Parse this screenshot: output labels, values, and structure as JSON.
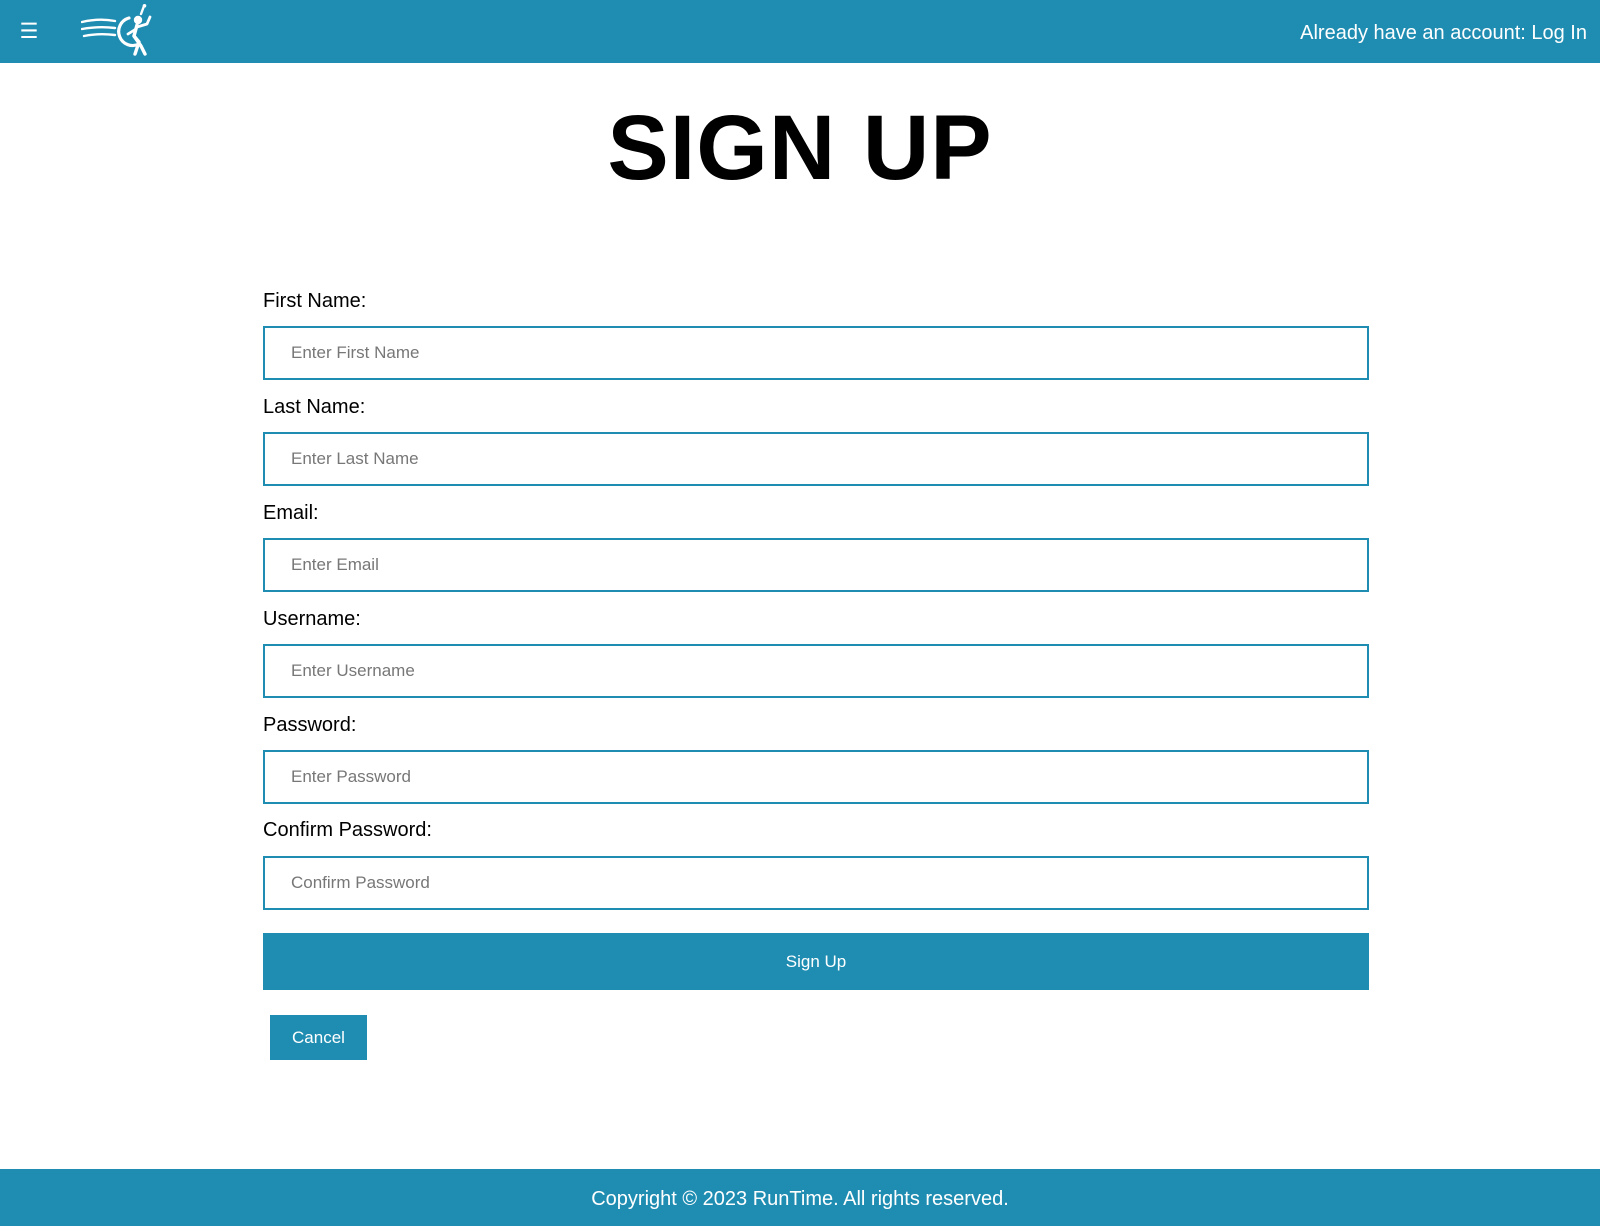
{
  "header": {
    "menu_icon_glyph": "☰",
    "logo_icon": "runner-logo-icon",
    "login_text": "Already have an account: Log In"
  },
  "page": {
    "title": "SIGN UP"
  },
  "form": {
    "fields": [
      {
        "label": "First Name:",
        "placeholder": "Enter First Name",
        "value": ""
      },
      {
        "label": "Last Name:",
        "placeholder": "Enter Last Name",
        "value": ""
      },
      {
        "label": "Email:",
        "placeholder": "Enter Email",
        "value": ""
      },
      {
        "label": "Username:",
        "placeholder": "Enter Username",
        "value": ""
      },
      {
        "label": "Password:",
        "placeholder": "Enter Password",
        "value": ""
      },
      {
        "label": "Confirm Password:",
        "placeholder": "Confirm Password",
        "value": ""
      }
    ],
    "submit_label": "Sign Up",
    "cancel_label": "Cancel"
  },
  "footer": {
    "copyright": "Copyright © 2023 RunTime. All rights reserved."
  },
  "colors": {
    "brand": "#1f8db2",
    "text_on_brand": "#ffffff",
    "background": "#ffffff"
  }
}
